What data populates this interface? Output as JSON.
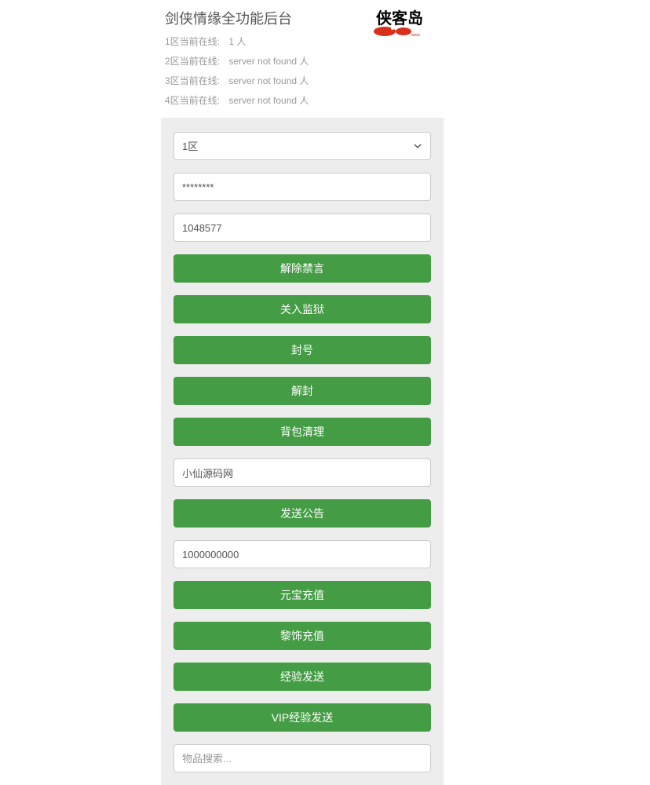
{
  "header": {
    "title": "剑侠情缘全功能后台",
    "online": [
      {
        "label": "1区当前在线:",
        "value": "1 人"
      },
      {
        "label": "2区当前在线:",
        "value": "server not found 人"
      },
      {
        "label": "3区当前在线:",
        "value": "server not found 人"
      },
      {
        "label": "4区当前在线:",
        "value": "server not found 人"
      }
    ],
    "logo_text_top": "侠客岛"
  },
  "form": {
    "zone_select": {
      "selected": "1区"
    },
    "password_value": "********",
    "id_value": "1048577",
    "btn_unmute": "解除禁言",
    "btn_jail": "关入监狱",
    "btn_ban": "封号",
    "btn_unban": "解封",
    "btn_clear_bag": "背包清理",
    "announce_value": "小仙源码网",
    "btn_send_announce": "发送公告",
    "amount_value": "1000000000",
    "btn_yuanbao": "元宝充值",
    "btn_lishi": "黎饰充值",
    "btn_exp": "经验发送",
    "btn_vip_exp": "VIP经验发送",
    "item_search_placeholder": "物品搜索..."
  }
}
